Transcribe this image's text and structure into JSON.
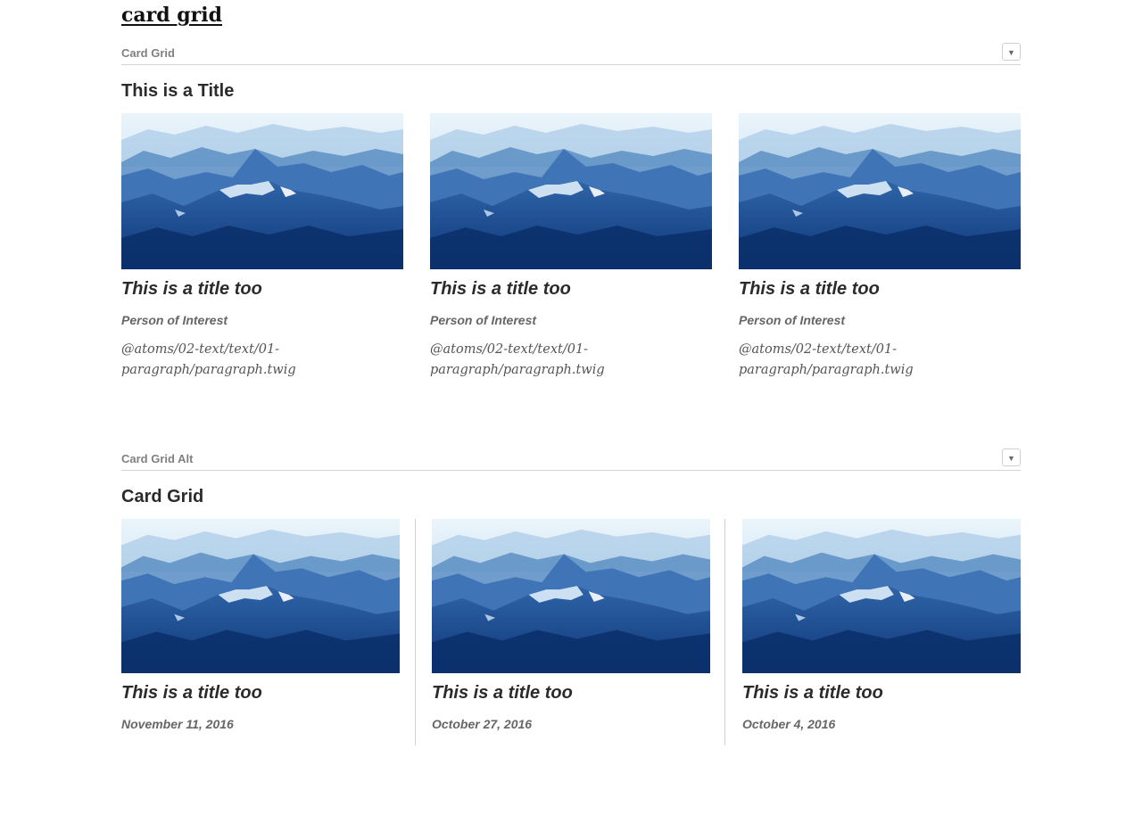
{
  "page": {
    "title": "card grid"
  },
  "sections": [
    {
      "header": "Card Grid",
      "toggle": "▼",
      "title": "This is a Title",
      "cards": [
        {
          "title": "This is a title too",
          "subtitle": "Person of Interest",
          "body": "@atoms/02-text/text/01-paragraph/paragraph.twig"
        },
        {
          "title": "This is a title too",
          "subtitle": "Person of Interest",
          "body": "@atoms/02-text/text/01-paragraph/paragraph.twig"
        },
        {
          "title": "This is a title too",
          "subtitle": "Person of Interest",
          "body": "@atoms/02-text/text/01-paragraph/paragraph.twig"
        }
      ]
    },
    {
      "header": "Card Grid Alt",
      "toggle": "▼",
      "title": "Card Grid",
      "cards": [
        {
          "title": "This is a title too",
          "date": "November 11, 2016"
        },
        {
          "title": "This is a title too",
          "date": "October 27, 2016"
        },
        {
          "title": "This is a title too",
          "date": "October 4, 2016"
        }
      ]
    }
  ],
  "colors": {
    "sky_top": "#eaf4fb",
    "haze": "#bcd8ee",
    "mountain_far": "#5d8fc4",
    "mountain_mid": "#2f64a8",
    "mountain_near": "#123f85",
    "snow": "#ffffff"
  }
}
